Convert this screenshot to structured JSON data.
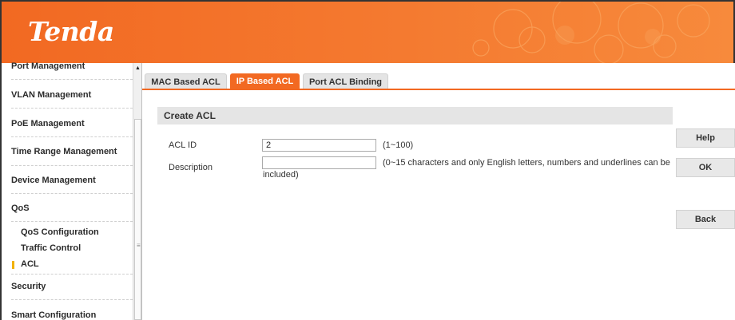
{
  "header": {
    "logo_text": "Tenda",
    "brand_color": "#f26922"
  },
  "sidebar": {
    "items": [
      {
        "label": "Port Management"
      },
      {
        "label": "VLAN Management"
      },
      {
        "label": "PoE Management"
      },
      {
        "label": "Time Range Management"
      },
      {
        "label": "Device Management"
      },
      {
        "label": "QoS"
      },
      {
        "label": "QoS Configuration"
      },
      {
        "label": "Traffic Control"
      },
      {
        "label": "ACL",
        "selected": true
      },
      {
        "label": "Security"
      },
      {
        "label": "Smart Configuration"
      }
    ],
    "scroll_up_icon": "▲",
    "scroll_grip_icon": "≡"
  },
  "tabs": [
    {
      "label": "MAC Based ACL",
      "active": false
    },
    {
      "label": "IP Based ACL",
      "active": true
    },
    {
      "label": "Port ACL Binding",
      "active": false
    }
  ],
  "form": {
    "section_title": "Create ACL",
    "acl_id": {
      "label": "ACL ID",
      "value": "2",
      "hint": "(1~100)"
    },
    "description": {
      "label": "Description",
      "value": "",
      "hint_line1": "(0~15 characters and only English letters, numbers and underlines can be",
      "hint_line2": "included)"
    }
  },
  "buttons": {
    "help": "Help",
    "ok": "OK",
    "back": "Back"
  }
}
